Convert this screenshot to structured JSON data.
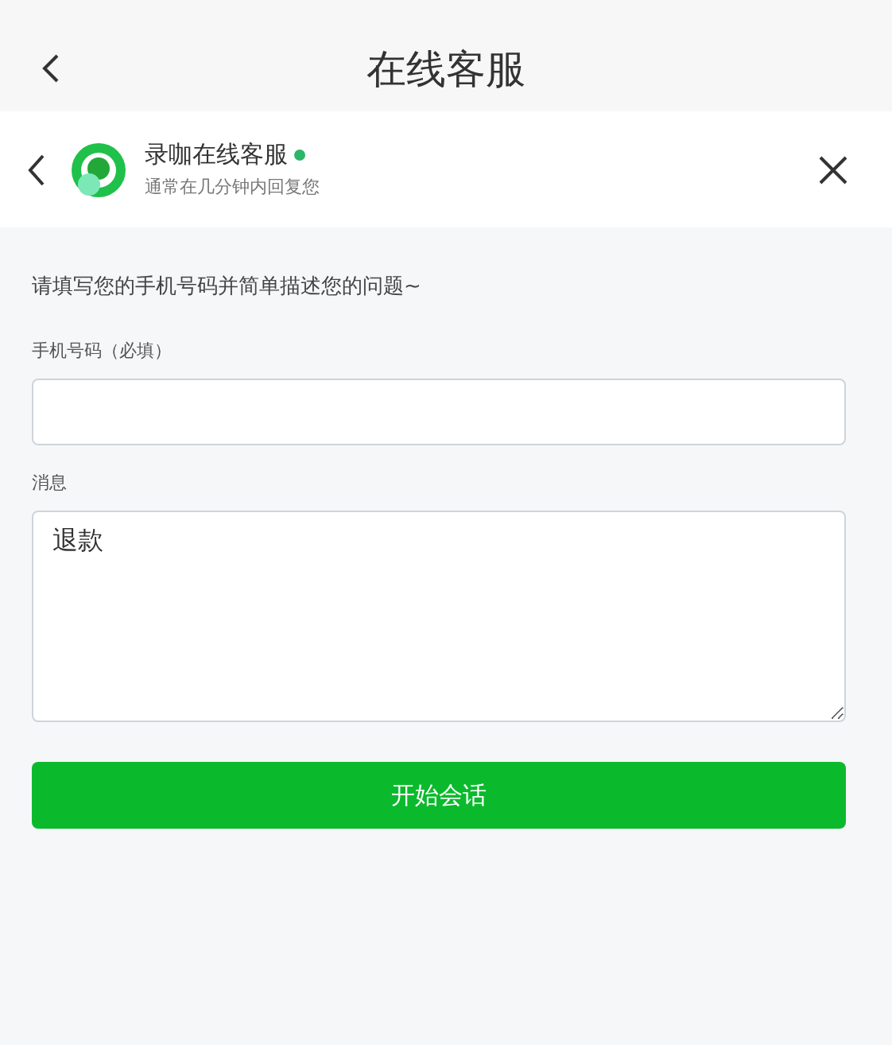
{
  "nav_bar": {
    "title": "在线客服"
  },
  "chat_header": {
    "name": "录咖在线客服",
    "online": true,
    "subtitle": "通常在几分钟内回复您"
  },
  "form": {
    "intro": "请填写您的手机号码并简单描述您的问题~",
    "fields": [
      {
        "label": "手机号码（必填）",
        "kind": "input"
      },
      {
        "label": "消息",
        "kind": "textarea",
        "value": "退款"
      }
    ],
    "submit": "开始会话"
  }
}
